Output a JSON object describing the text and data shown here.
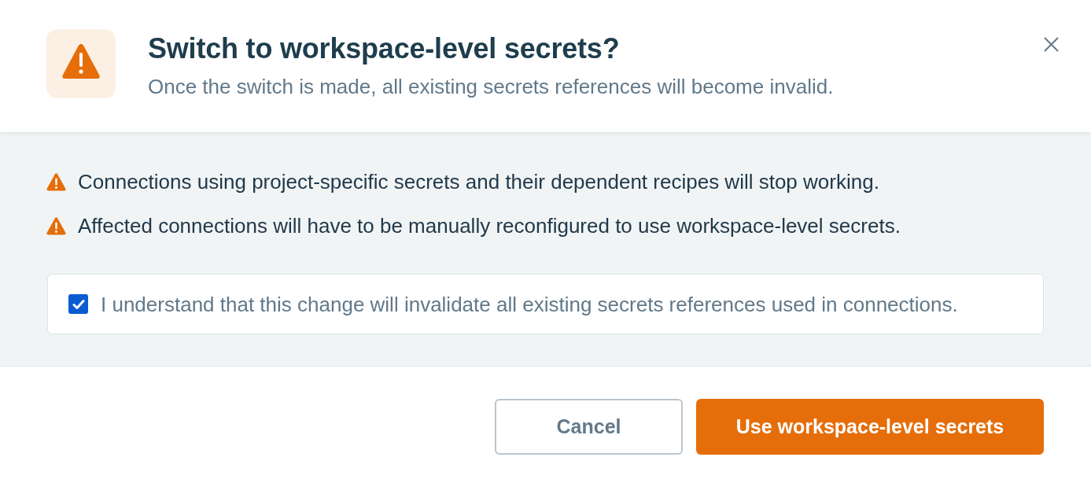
{
  "dialog": {
    "title": "Switch to workspace-level secrets?",
    "subtitle": "Once the switch is made, all existing secrets references will become invalid."
  },
  "warnings": [
    {
      "text": "Connections using project-specific secrets and their dependent recipes will stop working."
    },
    {
      "text": "Affected connections will have to be manually reconfigured to use workspace-level secrets."
    }
  ],
  "confirmation": {
    "label": "I understand that this change will invalidate all existing secrets references used in connections.",
    "checked": true
  },
  "buttons": [
    {
      "label": "Cancel",
      "kind": "secondary"
    },
    {
      "label": "Use workspace-level secrets",
      "kind": "primary"
    }
  ]
}
